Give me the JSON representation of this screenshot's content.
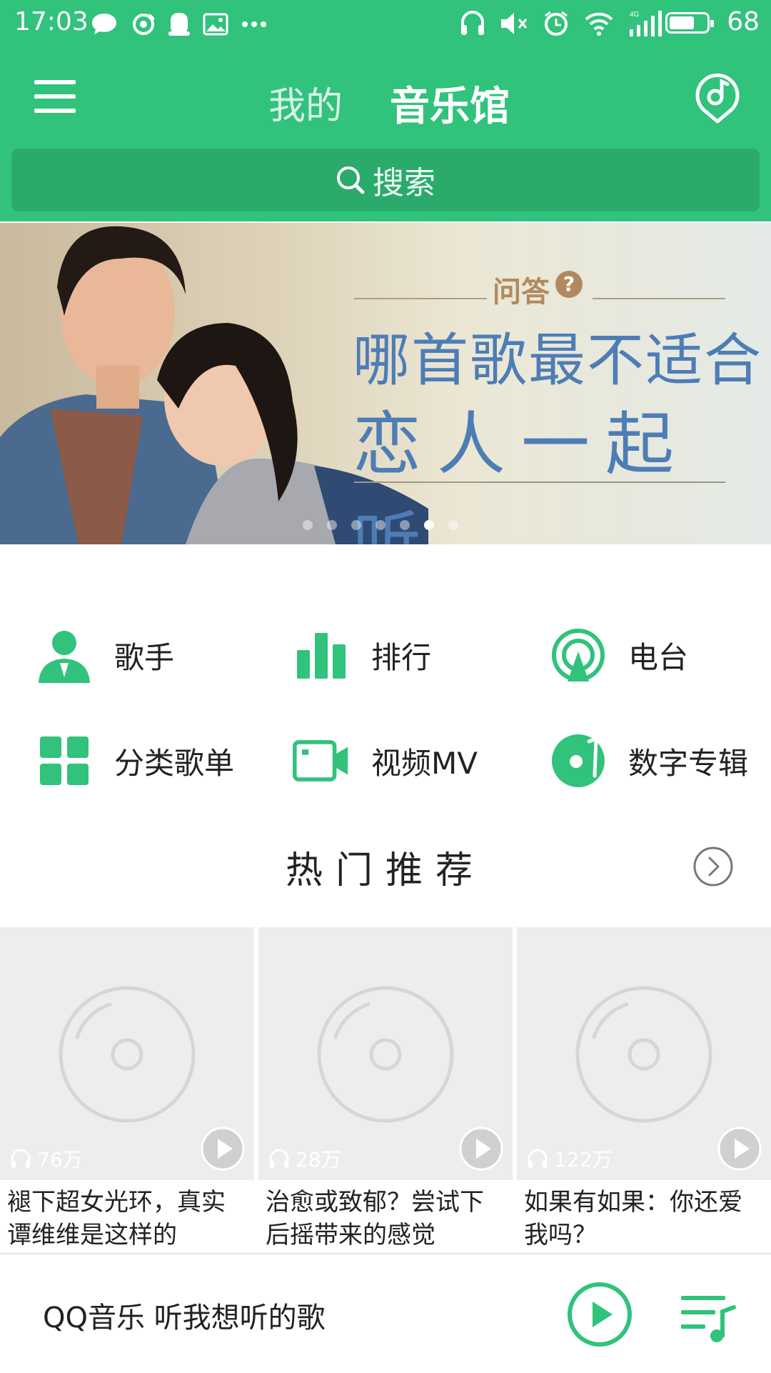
{
  "status_bar": {
    "time": "17:03",
    "battery_level": "68",
    "battery_fraction": 0.68,
    "network": "4G",
    "left_icons": [
      "message-icon",
      "weibo-icon",
      "qq-icon",
      "image-icon",
      "more-dots-icon"
    ],
    "right_icons": [
      "headphone-icon",
      "mute-icon",
      "alarm-icon",
      "wifi-icon",
      "signal-icon",
      "battery-icon"
    ]
  },
  "header": {
    "tab_mine": "我的",
    "tab_music_hall": "音乐馆",
    "search_placeholder": "搜索",
    "accent_color": "#31c27c"
  },
  "banner": {
    "qa_label": "问答",
    "qa_badge": "?",
    "line1": "哪首歌最不适合",
    "line2": "恋人一起听",
    "dot_count": 7,
    "active_dot": 5
  },
  "categories": [
    {
      "label": "歌手",
      "icon": "singer-icon"
    },
    {
      "label": "排行",
      "icon": "ranking-icon"
    },
    {
      "label": "电台",
      "icon": "radio-icon"
    },
    {
      "label": "分类歌单",
      "icon": "category-grid-icon"
    },
    {
      "label": "视频MV",
      "icon": "video-icon"
    },
    {
      "label": "数字专辑",
      "icon": "digital-album-icon"
    }
  ],
  "hot": {
    "title": "热门推荐",
    "cards": [
      {
        "plays": "76万",
        "title": "褪下超女光环，真实谭维维是这样的"
      },
      {
        "plays": "28万",
        "title": "治愈或致郁？尝试下后摇带来的感觉"
      },
      {
        "plays": "122万",
        "title": "如果有如果：你还爱我吗？"
      }
    ]
  },
  "player": {
    "title": "QQ音乐 听我想听的歌"
  }
}
